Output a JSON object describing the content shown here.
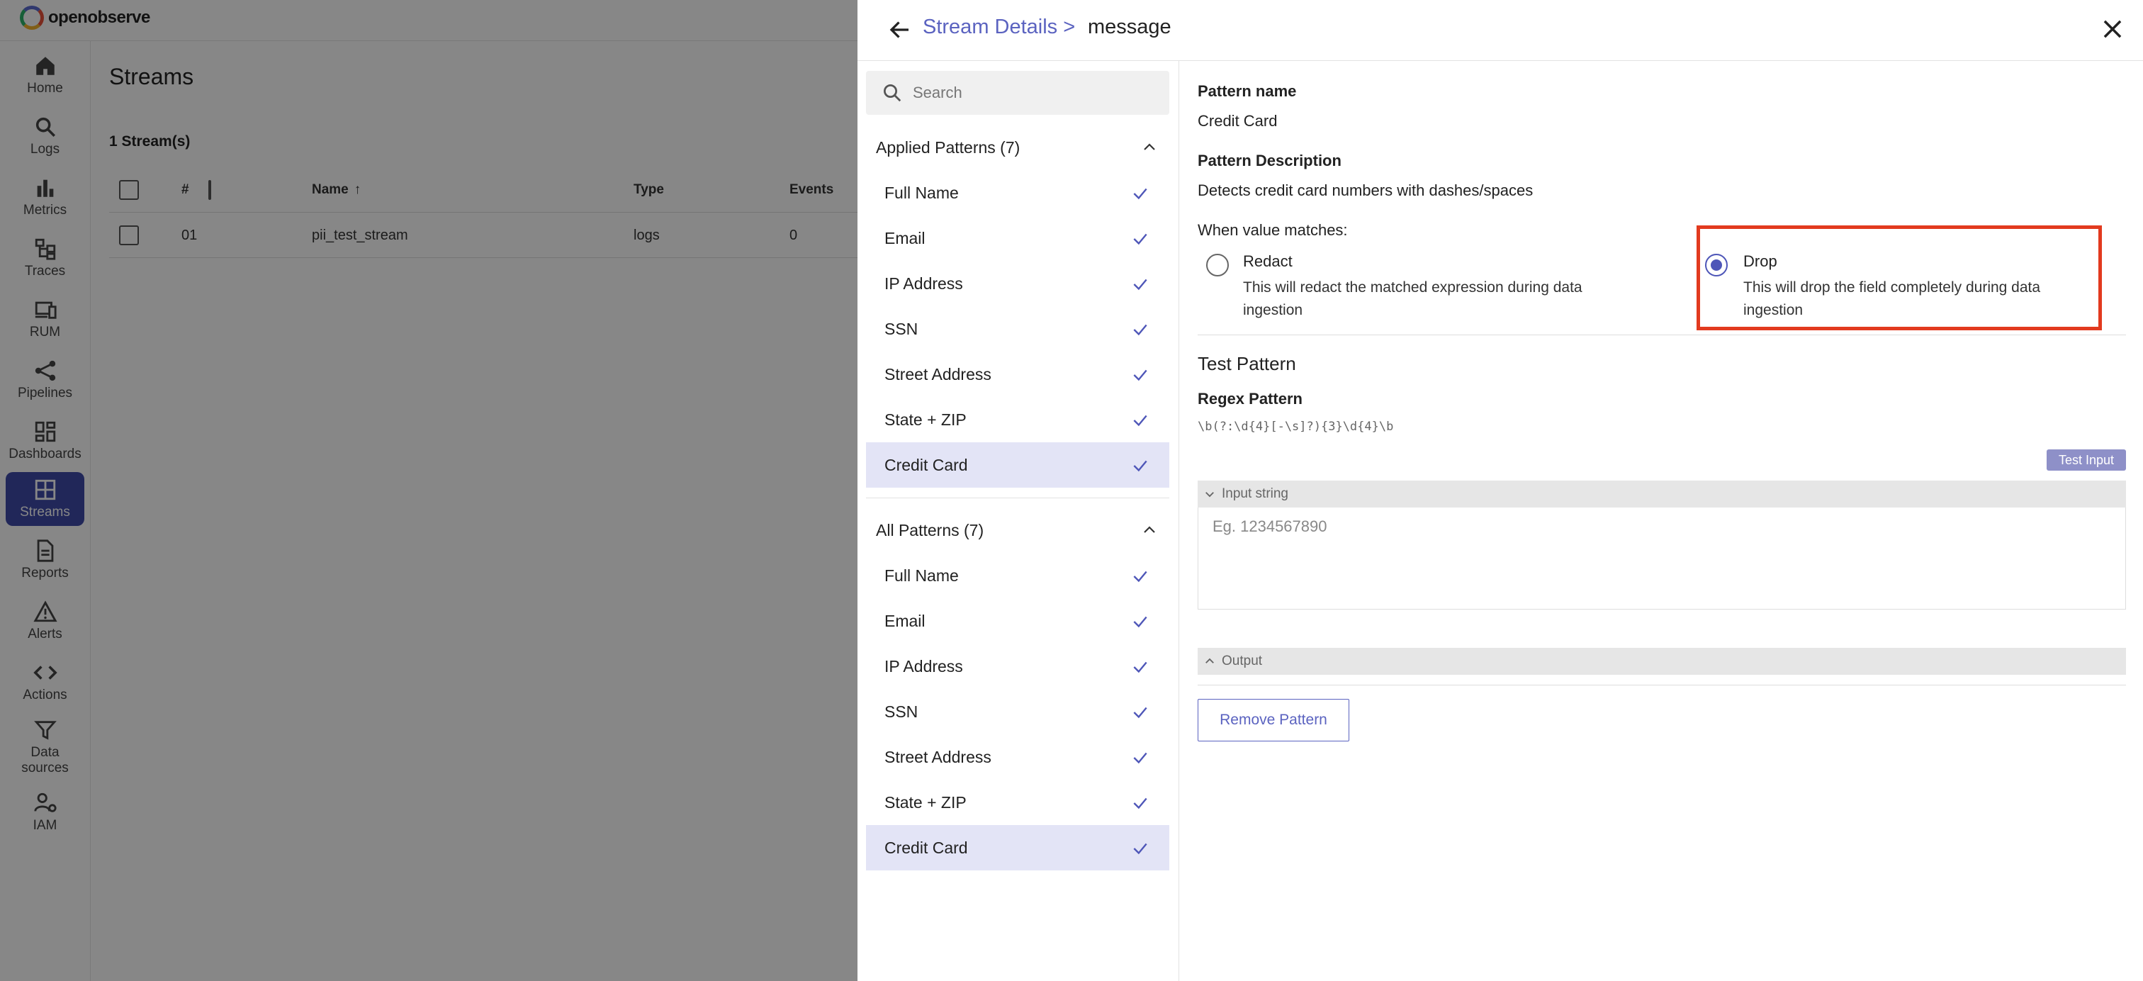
{
  "app": {
    "logo_text": "openobserve"
  },
  "nav": [
    {
      "label": "Home",
      "icon": "home-icon"
    },
    {
      "label": "Logs",
      "icon": "search-icon"
    },
    {
      "label": "Metrics",
      "icon": "bar-chart-icon"
    },
    {
      "label": "Traces",
      "icon": "hierarchy-icon"
    },
    {
      "label": "RUM",
      "icon": "devices-icon"
    },
    {
      "label": "Pipelines",
      "icon": "share-icon"
    },
    {
      "label": "Dashboards",
      "icon": "dashboard-icon"
    },
    {
      "label": "Streams",
      "icon": "grid-icon",
      "active": true
    },
    {
      "label": "Reports",
      "icon": "document-icon"
    },
    {
      "label": "Alerts",
      "icon": "warning-icon"
    },
    {
      "label": "Actions",
      "icon": "code-icon"
    },
    {
      "label": "Data sources",
      "icon": "filter-icon"
    },
    {
      "label": "IAM",
      "icon": "users-gear-icon"
    }
  ],
  "streams_page": {
    "title": "Streams",
    "count_label": "1 Stream(s)",
    "columns": [
      "#",
      "Name",
      "Type",
      "Events"
    ],
    "rows": [
      {
        "index": "01",
        "name": "pii_test_stream",
        "type": "logs",
        "events": "0"
      }
    ]
  },
  "drawer": {
    "breadcrumb_parent": "Stream Details >",
    "breadcrumb_current": "message",
    "search": {
      "placeholder": "Search",
      "value": ""
    },
    "applied_patterns": {
      "title": "Applied Patterns (7)",
      "items": [
        "Full Name",
        "Email",
        "IP Address",
        "SSN",
        "Street Address",
        "State + ZIP",
        "Credit Card"
      ],
      "selected": "Credit Card"
    },
    "all_patterns": {
      "title": "All Patterns (7)",
      "items": [
        "Full Name",
        "Email",
        "IP Address",
        "SSN",
        "Street Address",
        "State + ZIP",
        "Credit Card"
      ],
      "selected": "Credit Card"
    },
    "detail": {
      "pattern_name_label": "Pattern name",
      "pattern_name": "Credit Card",
      "description_label": "Pattern Description",
      "description": "Detects credit card numbers with dashes/spaces",
      "match_label": "When value matches:",
      "options": [
        {
          "title": "Redact",
          "desc": "This will redact the matched expression during data ingestion",
          "checked": false
        },
        {
          "title": "Drop",
          "desc": "This will drop the field completely during data ingestion",
          "checked": true
        }
      ],
      "test_heading": "Test Pattern",
      "regex_label": "Regex Pattern",
      "regex": "\\b(?:\\d{4}[-\\s]?){3}\\d{4}\\b",
      "test_button": "Test Input",
      "input_bar": "Input string",
      "input_placeholder": "Eg. 1234567890",
      "output_bar": "Output",
      "remove_button": "Remove Pattern"
    }
  },
  "colors": {
    "accent": "#5b63c0",
    "active_nav": "#3f4ba8",
    "highlight": "#e23a1f",
    "selected_row": "#e3e4f6"
  }
}
